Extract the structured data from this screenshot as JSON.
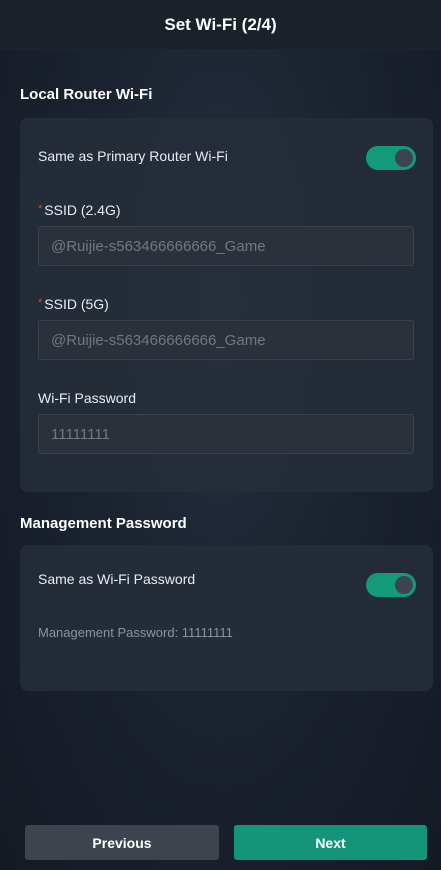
{
  "header": {
    "title": "Set Wi-Fi (2/4)"
  },
  "local_wifi": {
    "section_title": "Local Router Wi-Fi",
    "same_as_primary_label": "Same as Primary Router Wi-Fi",
    "same_as_primary_on": true,
    "ssid_24_label": "SSID (2.4G)",
    "ssid_24_value": "@Ruijie-s563466666666_Game",
    "ssid_5_label": "SSID (5G)",
    "ssid_5_value": "@Ruijie-s563466666666_Game",
    "password_label": "Wi-Fi Password",
    "password_value": "11111111",
    "required_mark": "*"
  },
  "management": {
    "section_title": "Management Password",
    "same_as_wifi_label": "Same as Wi-Fi Password",
    "same_as_wifi_on": true,
    "password_text": "Management Password: 11111111"
  },
  "footer": {
    "previous_label": "Previous",
    "next_label": "Next"
  },
  "colors": {
    "accent": "#14957a",
    "required": "#e0463a"
  }
}
